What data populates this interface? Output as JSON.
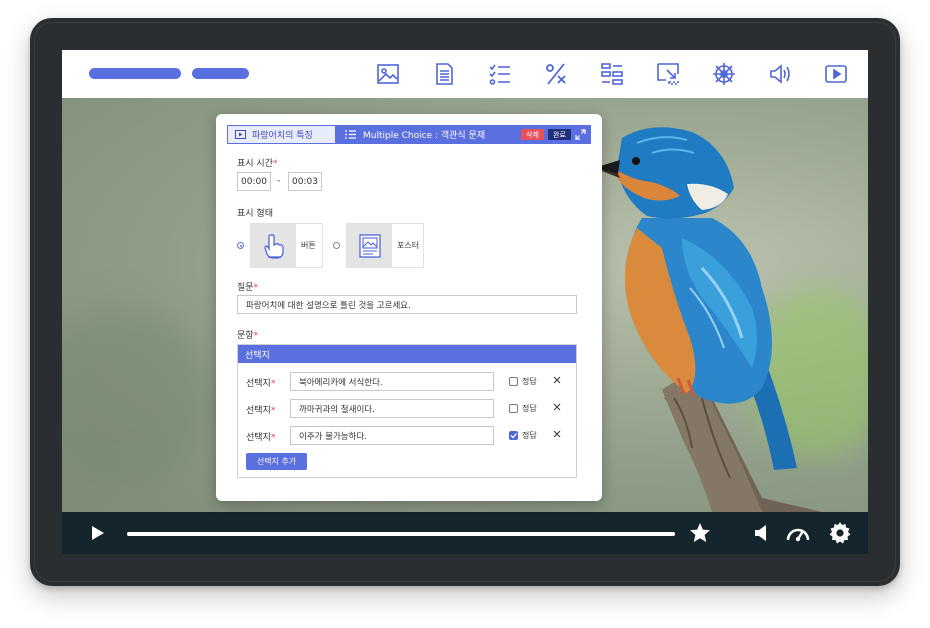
{
  "toolbar": {
    "tools": [
      "image-icon",
      "document-icon",
      "checklist-icon",
      "percent-icon",
      "layout-icon",
      "resize-icon",
      "helm-icon",
      "volume-icon",
      "video-icon"
    ]
  },
  "dialog": {
    "tab_chapter": "파랑어치의 특징",
    "tab_type": "Multiple Choice : 객관식 문제",
    "delete_label": "삭제",
    "done_label": "완료",
    "display_time_label": "표시 시간",
    "start_time": "00:00",
    "time_separator": "-",
    "end_time": "00:03",
    "display_type_label": "표시 형태",
    "type_button": "버튼",
    "type_poster": "포스터",
    "question_label": "질문",
    "question_value": "파랑어치에 대한 설명으로 틀린 것을 고르세요.",
    "items_label": "문항",
    "options_header": "선택지",
    "options": [
      {
        "label": "선택지",
        "value": "북아메리카에 서식한다.",
        "correct_label": "정답",
        "correct": false
      },
      {
        "label": "선택지",
        "value": "까마귀과의 철새이다.",
        "correct_label": "정답",
        "correct": false
      },
      {
        "label": "선택지",
        "value": "이주가 불가능하다.",
        "correct_label": "정답",
        "correct": true
      }
    ],
    "add_option_label": "선택지 추가",
    "required_mark": "*"
  },
  "player": {
    "progress": 1.0
  },
  "colors": {
    "accent": "#5a6fe0",
    "control_bar": "#14262b",
    "delete_badge": "#e8505b",
    "done_badge": "#1f2f7a"
  }
}
